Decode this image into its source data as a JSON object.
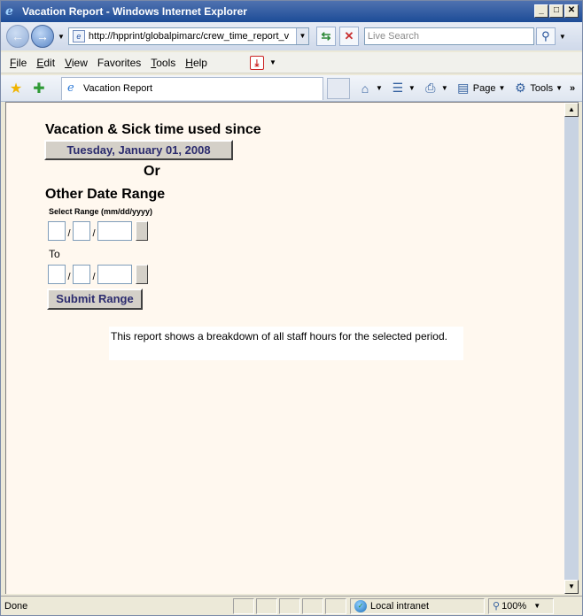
{
  "window": {
    "title": "Vacation Report - Windows Internet Explorer",
    "buttons": {
      "minimize": "_",
      "maximize": "□",
      "close": "✕"
    }
  },
  "address_bar": {
    "url": "http://hpprint/globalpimarc/crew_time_report_v",
    "search_placeholder": "Live Search"
  },
  "menu": {
    "items": [
      {
        "prefix": "F",
        "rest": "ile"
      },
      {
        "prefix": "E",
        "rest": "dit"
      },
      {
        "prefix": "V",
        "rest": "iew"
      },
      {
        "prefix": "F",
        "rest": "avorites",
        "underline_index": 2
      },
      {
        "prefix": "T",
        "rest": "ools"
      },
      {
        "prefix": "H",
        "rest": "elp"
      }
    ]
  },
  "favbar": {
    "tab_title": "Vacation Report",
    "commands": {
      "page": "Page",
      "tools": "Tools"
    }
  },
  "page": {
    "heading": "Vacation & Sick time used since",
    "since_date": "Tuesday, January 01, 2008",
    "or": "Or",
    "other_range": "Other Date Range",
    "range_label": "Select Range (mm/dd/yyyy)",
    "date_sep": "/",
    "to_label": "To",
    "submit": "Submit Range",
    "note": "This report shows a breakdown of all staff hours for the selected period.",
    "from": {
      "mm": "",
      "dd": "",
      "yyyy": ""
    },
    "to": {
      "mm": "",
      "dd": "",
      "yyyy": ""
    }
  },
  "status": {
    "text": "Done",
    "zone": "Local intranet",
    "zoom": "100%"
  },
  "icons": {
    "ie": "ie-logo-icon",
    "back": "back-arrow-icon",
    "forward": "forward-arrow-icon",
    "refresh": "refresh-icon",
    "stop": "stop-icon",
    "search": "search-icon",
    "favorites": "favorites-star-icon",
    "add_favorite": "add-favorite-icon",
    "home": "home-icon",
    "feeds": "feeds-icon",
    "print": "printer-icon",
    "page": "page-icon",
    "tools": "gear-icon",
    "zone": "globe-icon"
  }
}
